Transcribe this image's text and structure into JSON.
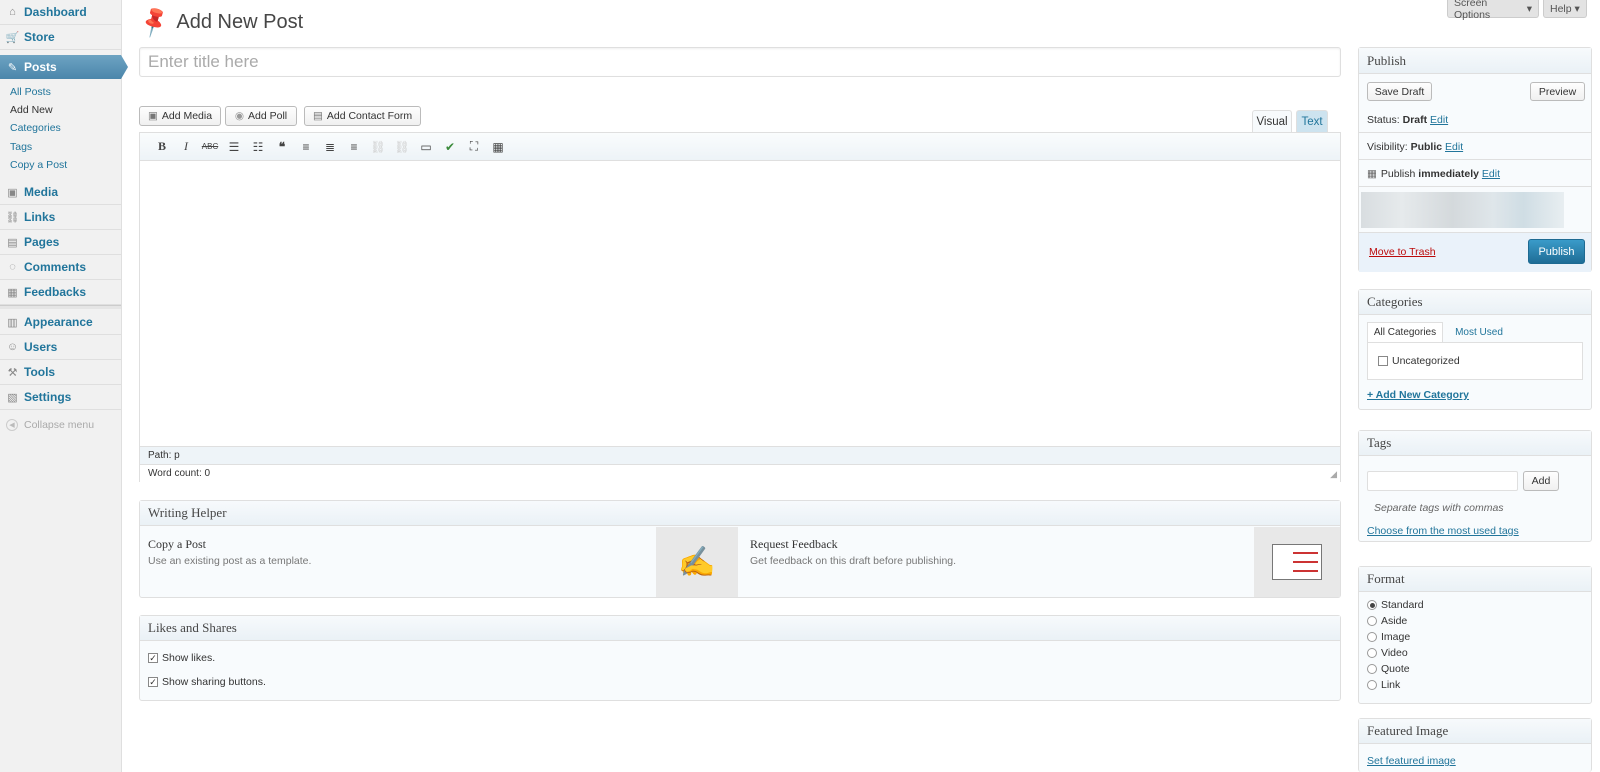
{
  "menu": {
    "dashboard": "Dashboard",
    "store": "Store",
    "posts": "Posts",
    "posts_sub": [
      "All Posts",
      "Add New",
      "Categories",
      "Tags",
      "Copy a Post"
    ],
    "media": "Media",
    "links": "Links",
    "pages": "Pages",
    "comments": "Comments",
    "feedbacks": "Feedbacks",
    "appearance": "Appearance",
    "users": "Users",
    "tools": "Tools",
    "settings": "Settings",
    "collapse": "Collapse menu"
  },
  "screen_options": "Screen Options",
  "help": "Help",
  "page_title": "Add New Post",
  "title_placeholder": "Enter title here",
  "media_buttons": {
    "add_media": "Add Media",
    "add_poll": "Add Poll",
    "add_contact_form": "Add Contact Form"
  },
  "editor": {
    "tab_visual": "Visual",
    "tab_text": "Text",
    "path": "Path: p",
    "word_count": "Word count: 0"
  },
  "writing_helper": {
    "title": "Writing Helper",
    "copy_title": "Copy a Post",
    "copy_desc": "Use an existing post as a template.",
    "feedback_title": "Request Feedback",
    "feedback_desc": "Get feedback on this draft before publishing."
  },
  "likes_shares": {
    "title": "Likes and Shares",
    "show_likes": "Show likes.",
    "show_sharing": "Show sharing buttons.",
    "show_likes_checked": true,
    "show_sharing_checked": true
  },
  "publish": {
    "title": "Publish",
    "save_draft": "Save Draft",
    "preview": "Preview",
    "status_label": "Status:",
    "status_value": "Draft",
    "visibility_label": "Visibility:",
    "visibility_value": "Public",
    "publish_label": "Publish",
    "publish_value": "immediately",
    "edit": "Edit",
    "move_to_trash": "Move to Trash",
    "publish_button": "Publish"
  },
  "categories": {
    "title": "Categories",
    "tab_all": "All Categories",
    "tab_most_used": "Most Used",
    "items": [
      "Uncategorized"
    ],
    "add_new": "+ Add New Category"
  },
  "tags": {
    "title": "Tags",
    "add": "Add",
    "hint": "Separate tags with commas",
    "choose": "Choose from the most used tags"
  },
  "format": {
    "title": "Format",
    "options": [
      "Standard",
      "Aside",
      "Image",
      "Video",
      "Quote",
      "Link"
    ],
    "selected": "Standard"
  },
  "featured_image": {
    "title": "Featured Image",
    "set": "Set featured image"
  },
  "colors": {
    "link": "#21759b",
    "posts_menu": "#4b86ab",
    "publish_button": "#2583b4",
    "trash": "#bc0b0b"
  }
}
